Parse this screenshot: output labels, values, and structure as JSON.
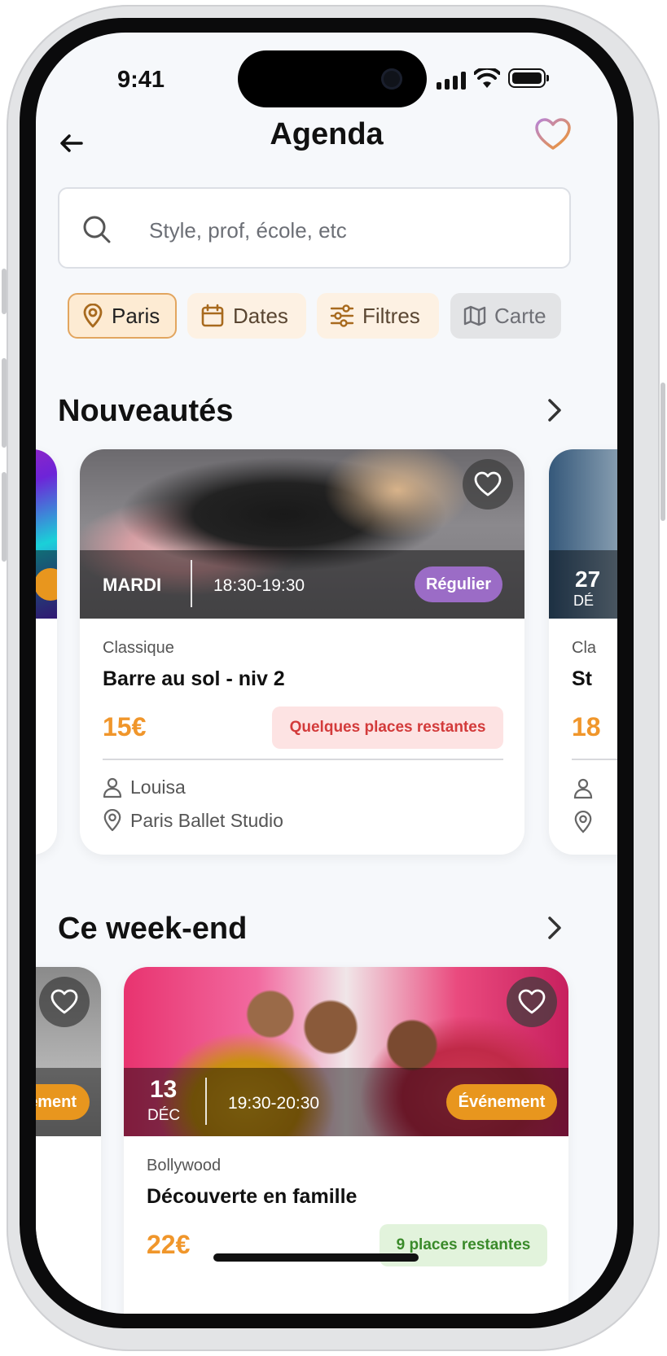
{
  "status_bar": {
    "time": "9:41"
  },
  "header": {
    "title": "Agenda"
  },
  "search": {
    "placeholder": "Style, prof, école, etc"
  },
  "filters": [
    {
      "label": "Paris",
      "icon": "location-pin-icon"
    },
    {
      "label": "Dates",
      "icon": "calendar-icon"
    },
    {
      "label": "Filtres",
      "icon": "sliders-icon"
    },
    {
      "label": "Carte",
      "icon": "map-icon"
    }
  ],
  "sections": {
    "new": {
      "title": "Nouveautés"
    },
    "weekend": {
      "title": "Ce week-end"
    }
  },
  "new_cards": {
    "main": {
      "day": "MARDI",
      "time": "18:30-19:30",
      "tag": "Régulier",
      "category": "Classique",
      "name": "Barre au sol - niv 2",
      "price": "15€",
      "availability": "Quelques places restantes",
      "teacher": "Louisa",
      "location": "Paris Ballet Studio"
    },
    "next_peek": {
      "date": "27",
      "month": "DÉ",
      "category": "Cla",
      "name": "St",
      "price": "18"
    }
  },
  "weekend_cards": {
    "prev_peek": {
      "tag": "ement"
    },
    "main": {
      "date": "13",
      "month": "DÉC",
      "time": "19:30-20:30",
      "tag": "Événement",
      "category": "Bollywood",
      "name": "Découverte en famille",
      "price": "22€",
      "availability": "9 places restantes"
    }
  },
  "colors": {
    "accent": "#f0962b",
    "tag_regulier": "#9b6cc6",
    "tag_evenement": "#e8961e",
    "availability_red": "#d33b3b",
    "availability_green_bg": "#e2f3dc"
  }
}
